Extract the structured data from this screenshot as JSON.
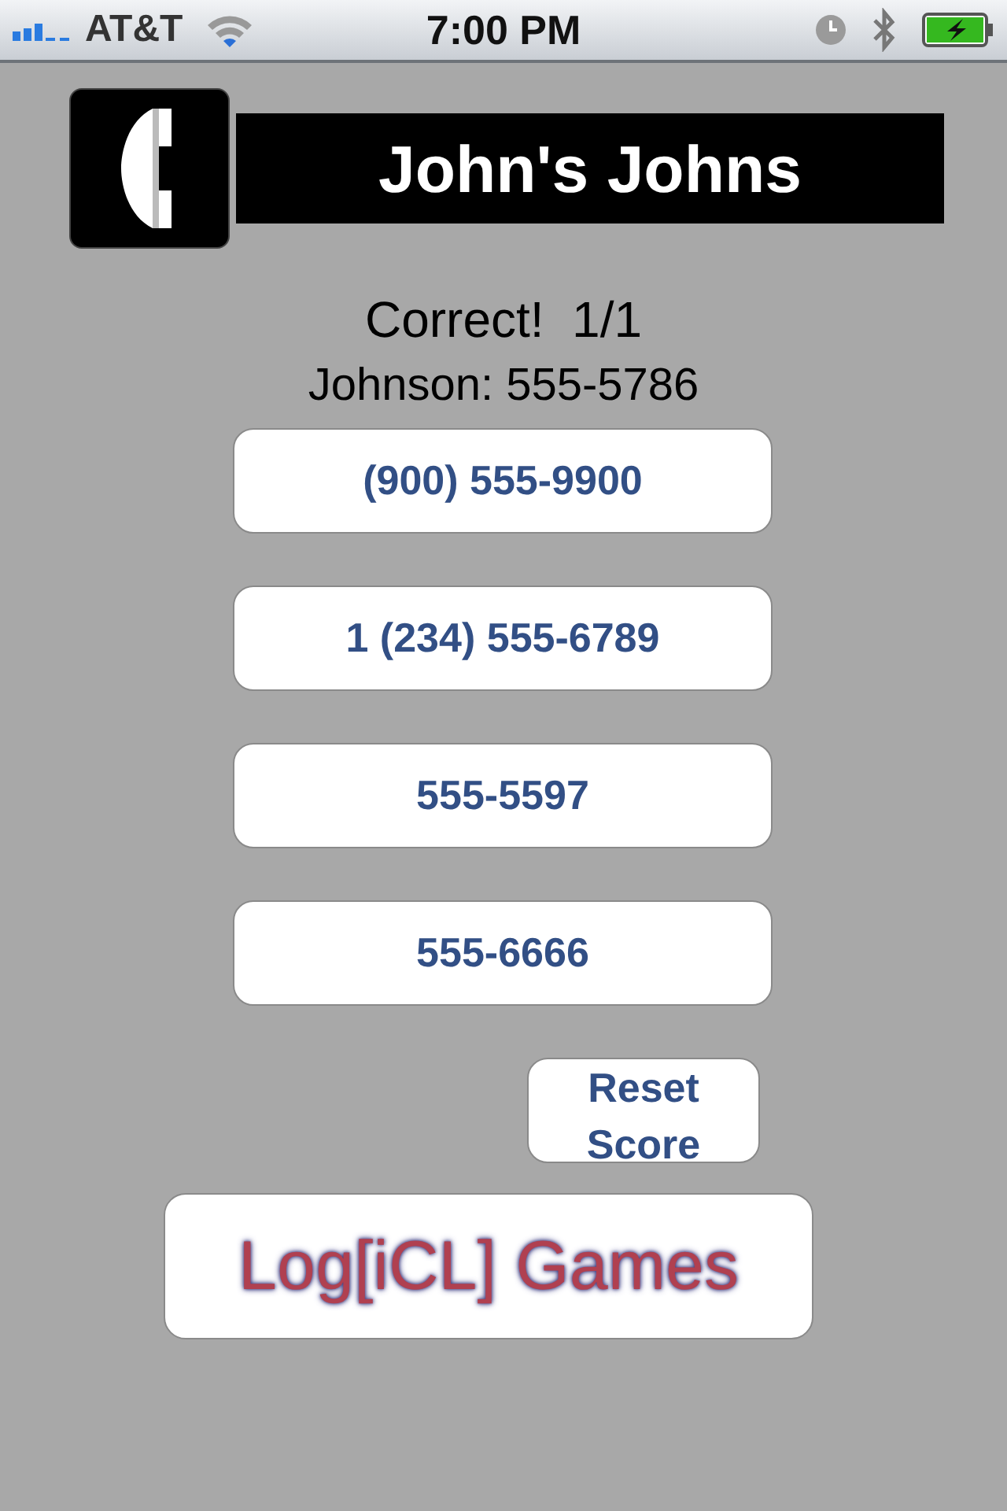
{
  "status_bar": {
    "carrier": "AT&T",
    "time": "7:00 PM"
  },
  "header": {
    "title": "John's Johns"
  },
  "result": "Correct!  1/1",
  "question": "Johnson: 555-5786",
  "answers": [
    {
      "label": "(900) 555-9900"
    },
    {
      "label": "1 (234) 555-6789"
    },
    {
      "label": "555-5597"
    },
    {
      "label": "555-6666"
    }
  ],
  "reset_button": "Reset Score",
  "logo_button": "Log[iCL] Games"
}
